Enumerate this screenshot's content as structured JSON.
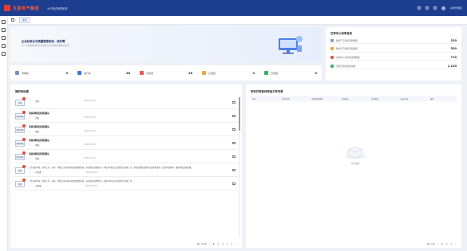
{
  "header": {
    "brand": "五星有汽集团",
    "system_name": "大众融合管理系统",
    "user": "系统管理员"
  },
  "tabs": [
    {
      "label": "首页"
    }
  ],
  "banner": {
    "title": "企业标准化与质量管理系统，您好啊",
    "subtitle": "新一代的数据化管控平台助力企业创新发展提高标准"
  },
  "stats": [
    {
      "label": "待审核",
      "value": "0",
      "color": "#7d8fb3"
    },
    {
      "label": "进行中",
      "value": "28",
      "color": "#3b74e0"
    },
    {
      "label": "已完成",
      "value": "28",
      "color": "#e6564a"
    },
    {
      "label": "已退回",
      "value": "4",
      "color": "#f0a23b"
    },
    {
      "label": "已驳回",
      "value": "0",
      "color": "#35b06a"
    }
  ],
  "todo": {
    "title": "已审中心待审任务",
    "items": [
      {
        "label": "跨部门已审核流程数量",
        "value": "220",
        "color": "#8a9bc0"
      },
      {
        "label": "跨地产已审核流程数量",
        "value": "530",
        "color": "#f0a23b"
      },
      {
        "label": "文件中心已审核流程数量",
        "value": "710",
        "color": "#e6564a"
      },
      {
        "label": "文件已审核流程总数",
        "value": "1,120",
        "color": "#35b06a"
      }
    ]
  },
  "left_panel": {
    "title": "我的待处理",
    "items": [
      {
        "tag": "签收",
        "name": "",
        "role": "草拟",
        "time": "2022-03-15",
        "body": ""
      },
      {
        "tag": "签收审核",
        "name": "审核材料报送流程确认",
        "role": "签批",
        "time": "2022-03-15",
        "body": ""
      },
      {
        "tag": "签收审核",
        "name": "审核材料报送流程确认",
        "role": "签批",
        "time": "2022-03-15",
        "body": ""
      },
      {
        "tag": "签收审核",
        "name": "审核材料报送流程确认",
        "role": "签批",
        "time": "2022-03-15",
        "body": ""
      },
      {
        "tag": "签收审核",
        "name": "审核材料报送流程确认",
        "role": "签批",
        "time": "2022-03-15",
        "body": ""
      },
      {
        "tag": "签收",
        "name": "",
        "role": "产品部",
        "time": "2022-03-15",
        "body": "工作流程审核：事项工作，内容：审批生活动态审核流程管理系统，标准规范流程要求，对相关单位结合实际情况开展工作，按照流程规范要求完成审批事项，提高审批效率，确保审批结果准确。"
      },
      {
        "tag": "签收",
        "name": "",
        "role": "产品部",
        "time": "2022-03-15",
        "body": "工作流程审核：事项工作，内容：审批生活动态审核流程管理系统，标准规范流程要求，对相关单位结合实际情况开展工作。"
      }
    ],
    "pager": {
      "total": "共计 20 条",
      "pages": [
        "1",
        "2",
        "3",
        "4",
        "5"
      ],
      "active": "1"
    }
  },
  "right_panel": {
    "title": "所有已审核待审批文件列表",
    "columns": [
      "序号",
      "文件名称",
      "审核流程类型",
      "文件编号",
      "文件类型",
      "发布时间",
      "操作"
    ],
    "empty_text": "暂无数据",
    "pager": {
      "total": "共计 0 条",
      "pages": [
        "1",
        "2",
        "3"
      ],
      "active": "1"
    }
  }
}
